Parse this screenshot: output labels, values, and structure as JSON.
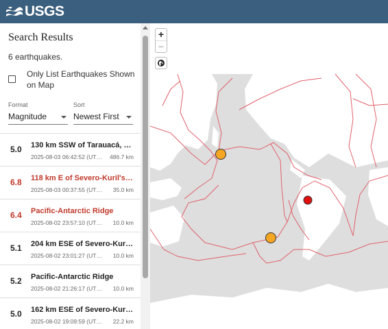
{
  "header": {
    "logo_text": "USGS"
  },
  "sidebar": {
    "title": "Search Results",
    "count": "6 earthquakes.",
    "filter_label": "Only List Earthquakes Shown on Map",
    "format": {
      "label": "Format",
      "value": "Magnitude"
    },
    "sort": {
      "label": "Sort",
      "value": "Newest First"
    }
  },
  "earthquakes": [
    {
      "mag": "5.0",
      "place": "130 km SSW of Tarauacá, Br...",
      "time": "2025-08-03 06:42:52 (UTC-0...",
      "depth": "486.7 km",
      "significant": false
    },
    {
      "mag": "6.8",
      "place": "118 km E of Severo-Kuril'sk, ...",
      "time": "2025-08-03 00:37:55 (UTC-0...",
      "depth": "35.0 km",
      "significant": true
    },
    {
      "mag": "6.4",
      "place": "Pacific-Antarctic Ridge",
      "time": "2025-08-02 23:57:10 (UTC-0...",
      "depth": "10.0 km",
      "significant": true
    },
    {
      "mag": "5.1",
      "place": "204 km ESE of Severo-Kuril's...",
      "time": "2025-08-02 23:01:27 (UTC-0...",
      "depth": "10.0 km",
      "significant": false
    },
    {
      "mag": "5.2",
      "place": "Pacific-Antarctic Ridge",
      "time": "2025-08-02 21:26:17 (UTC-0...",
      "depth": "10.0 km",
      "significant": false
    },
    {
      "mag": "5.0",
      "place": "162 km ESE of Severo-Kuril's...",
      "time": "2025-08-02 19:09:59 (UTC-0...",
      "depth": "22.2 km",
      "significant": false
    }
  ],
  "map": {
    "zoom_in": "+",
    "zoom_out": "−",
    "colors": {
      "ocean": "#dedede",
      "land": "#ffffff",
      "plates": "#e0606a",
      "marker_orange": "#f5a623",
      "marker_red": "#e01010"
    }
  }
}
